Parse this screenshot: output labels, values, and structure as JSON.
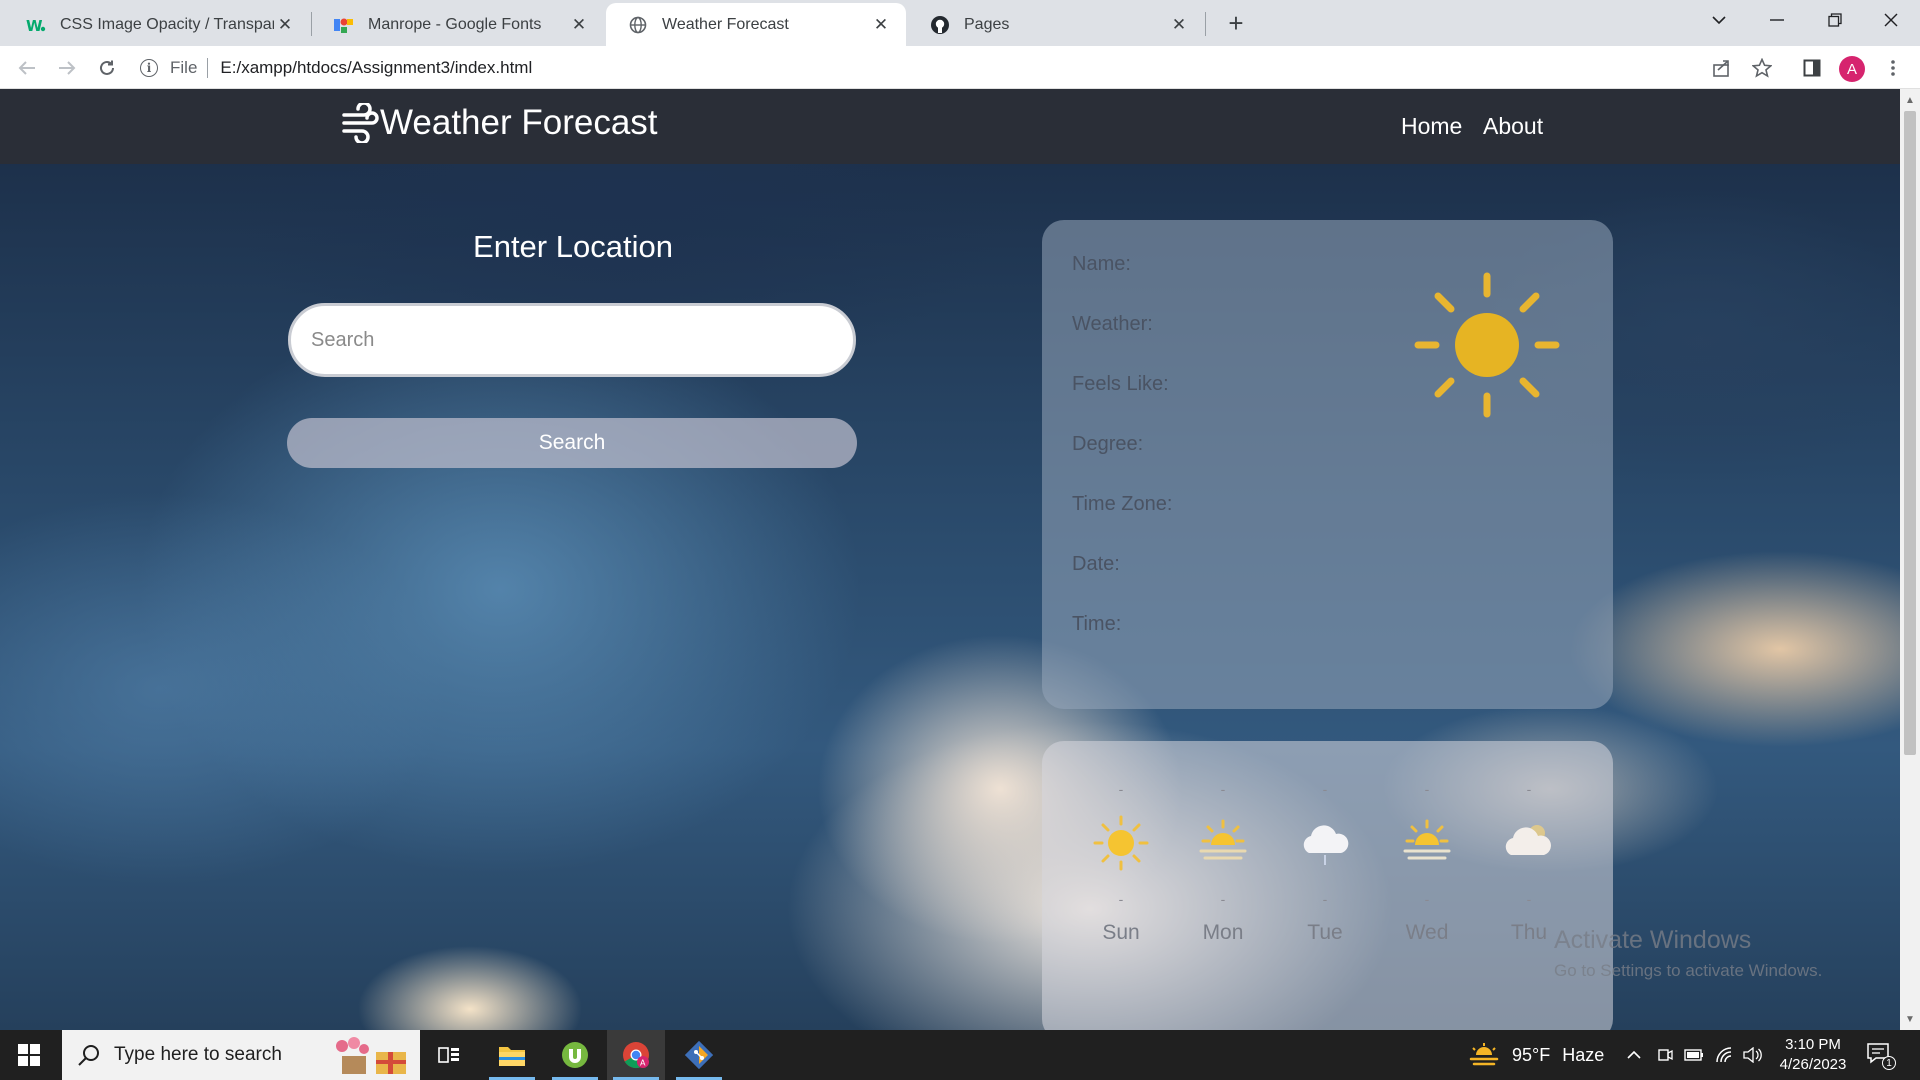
{
  "browser": {
    "tabs": [
      {
        "title": "CSS Image Opacity / Transparenc",
        "icon": "w3schools-icon"
      },
      {
        "title": "Manrope - Google Fonts",
        "icon": "google-fonts-icon"
      },
      {
        "title": "Weather Forecast",
        "icon": "globe-icon",
        "active": true
      },
      {
        "title": "Pages",
        "icon": "github-icon"
      }
    ],
    "address": {
      "scheme": "File",
      "url": "E:/xampp/htdocs/Assignment3/index.html"
    },
    "profile_initial": "A"
  },
  "site": {
    "brand": "Weather Forecast",
    "nav": [
      "Home",
      "About"
    ],
    "search_heading": "Enter Location",
    "search_placeholder": "Search",
    "search_button": "Search",
    "info_labels": [
      "Name:",
      "Weather:",
      "Feels Like:",
      "Degree:",
      "Time Zone:",
      "Date:",
      "Time:"
    ],
    "forecast": [
      {
        "day": "Sun",
        "top": "-",
        "bottom": "-",
        "icon": "sun-icon"
      },
      {
        "day": "Mon",
        "top": "-",
        "bottom": "-",
        "icon": "sun-haze-icon"
      },
      {
        "day": "Tue",
        "top": "-",
        "bottom": "-",
        "icon": "cloud-rain-icon"
      },
      {
        "day": "Wed",
        "top": "-",
        "bottom": "-",
        "icon": "sun-haze-icon"
      },
      {
        "day": "Thu",
        "top": "-",
        "bottom": "-",
        "icon": "cloud-icon"
      }
    ],
    "watermark": {
      "title": "Activate Windows",
      "subtitle": "Go to Settings to activate Windows."
    }
  },
  "taskbar": {
    "search_placeholder": "Type here to search",
    "weather": {
      "temp": "95°F",
      "condition": "Haze"
    },
    "time": "3:10 PM",
    "date": "4/26/2023",
    "notifications": "1"
  },
  "colors": {
    "navbar": "#2a2e37",
    "accent_sun": "#e8b530",
    "taskbar": "#202020"
  }
}
